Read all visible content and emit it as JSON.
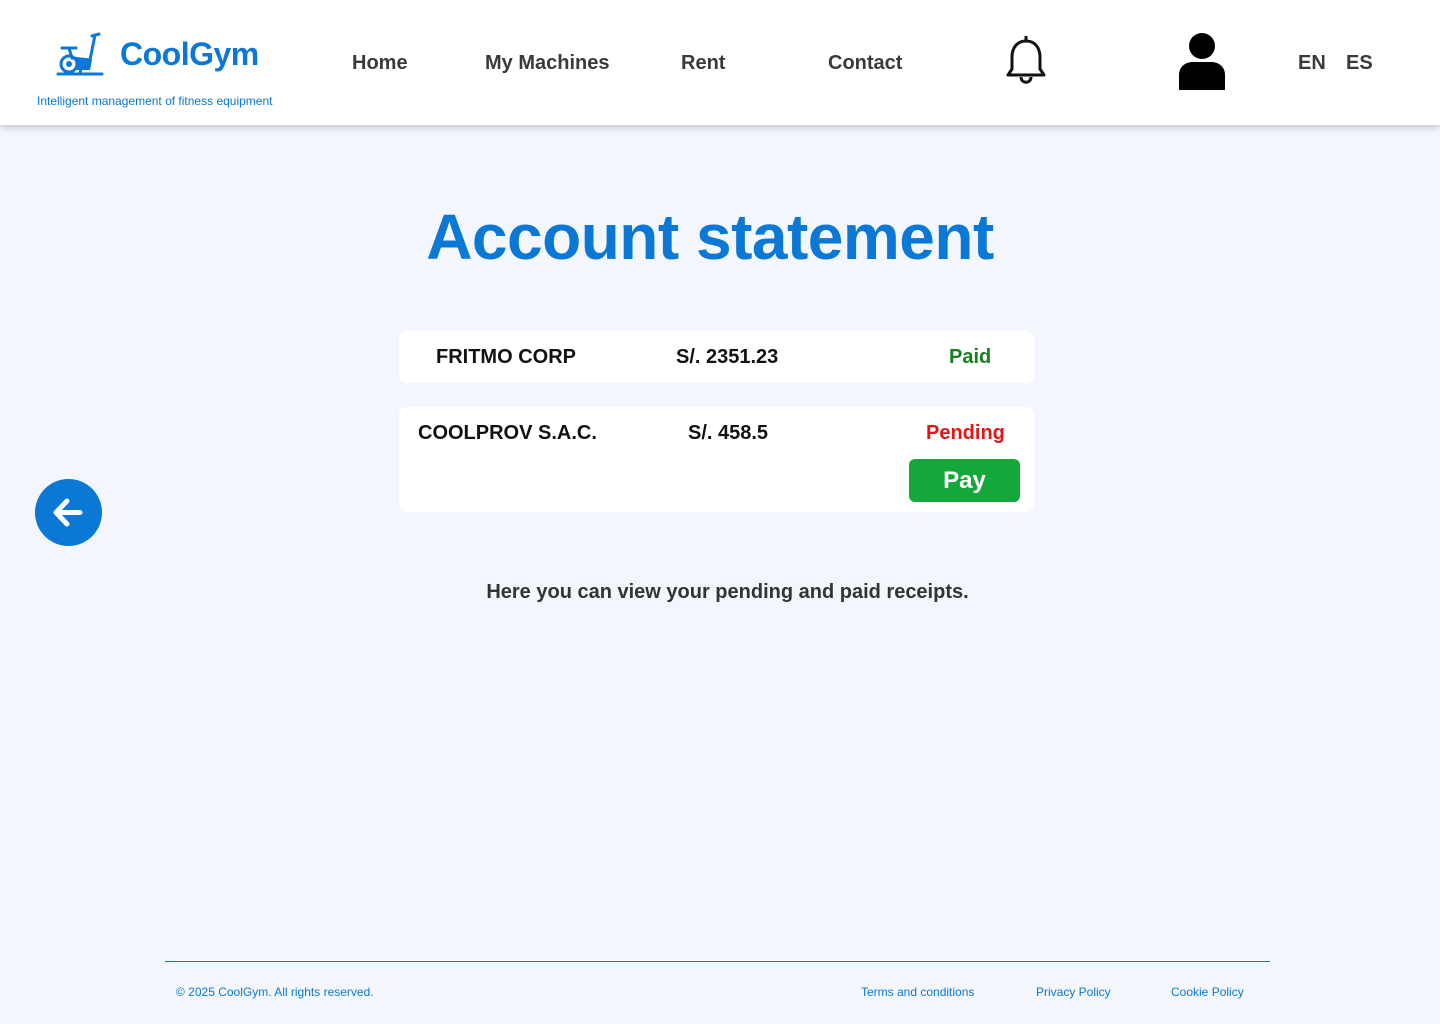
{
  "brand": {
    "name": "CoolGym",
    "tagline": "Intelligent management of fitness equipment",
    "logo_icon": "exercise-bike-icon",
    "color": "#0a78d4"
  },
  "nav": {
    "items": [
      {
        "label": "Home"
      },
      {
        "label": "My Machines"
      },
      {
        "label": "Rent"
      },
      {
        "label": "Contact"
      }
    ],
    "notifications_icon": "bell-icon",
    "profile_icon": "user-icon",
    "languages": [
      "EN",
      "ES"
    ]
  },
  "main": {
    "title": "Account statement",
    "statements": [
      {
        "company": "FRITMO CORP",
        "amount": "S/. 2351.23",
        "status": "Paid",
        "status_color": "#17811f"
      },
      {
        "company": "COOLPROV S.A.C.",
        "amount": "S/. 458.5",
        "status": "Pending",
        "status_color": "#e21616",
        "action_label": "Pay",
        "action_color": "#14a83a"
      }
    ],
    "info_text": "Here you can view your pending and paid receipts.",
    "back_icon": "arrow-left-icon"
  },
  "footer": {
    "copyright": "© 2025 CoolGym. All rights reserved.",
    "links": [
      {
        "label": "Terms and conditions"
      },
      {
        "label": "Privacy Policy"
      },
      {
        "label": "Cookie Policy"
      }
    ]
  }
}
